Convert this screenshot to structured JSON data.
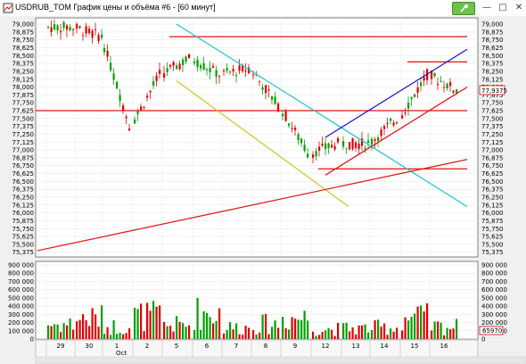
{
  "window": {
    "title": "USDRUB_TOM График цены и объёма #6 - [60 минут]",
    "minimize_icon": "minimize-icon",
    "maximize_icon": "maximize-icon",
    "close_icon": "close-icon",
    "pin_icon": "pin-icon"
  },
  "price_axis": {
    "labels": [
      "79,000",
      "78,875",
      "78,750",
      "78,625",
      "78,500",
      "78,375",
      "78,250",
      "78,125",
      "78,000",
      "77,875",
      "77,750",
      "77,625",
      "77,500",
      "77,375",
      "77,250",
      "77,125",
      "77,000",
      "76,875",
      "76,750",
      "76,625",
      "76,500",
      "76,375",
      "76,250",
      "76,125",
      "76,000",
      "75,875",
      "75,750",
      "75,625",
      "75,500",
      "75,375"
    ],
    "current_price": "77,9375",
    "current_price_color": "#e00000"
  },
  "volume_axis": {
    "labels": [
      "900 000",
      "800 000",
      "700 000",
      "600 000",
      "500 000",
      "400 000",
      "300 000",
      "200 000",
      "100 000",
      "0"
    ],
    "current_volume": "65970",
    "current_volume_color": "#e00000"
  },
  "time_axis": {
    "day_labels": [
      "29",
      "30",
      "1",
      "2",
      "5",
      "6",
      "7",
      "8",
      "9",
      "12",
      "13",
      "14",
      "15",
      "16"
    ],
    "month_label": "Oct"
  },
  "colors": {
    "up_candle": "#00a000",
    "down_candle": "#e00000",
    "volume_up": "#00a000",
    "volume_down": "#e00000",
    "cyan_line": "#20c0d0",
    "yellow_line": "#c8c820",
    "blue_line": "#1010d0",
    "red_line": "#e01010"
  },
  "chart_data": {
    "type": "line",
    "title": "",
    "xlabel": "",
    "ylabel": "",
    "ylim": [
      75.3,
      79.1
    ],
    "volume_ylim": [
      0,
      900000
    ],
    "categories": [
      "29",
      "30",
      "1",
      "2",
      "5",
      "6",
      "7",
      "8",
      "9",
      "12",
      "13",
      "14",
      "15",
      "16"
    ],
    "series": [
      {
        "values": [
          78.95,
          78.8,
          77.4,
          78.2,
          78.45,
          78.2,
          78.3,
          77.7,
          76.95,
          77.1,
          77.1,
          77.5,
          78.2,
          77.95
        ]
      }
    ],
    "volume": [
      180000,
      250000,
      150000,
      280000,
      170000,
      320000,
      140000,
      180000,
      260000,
      120000,
      130000,
      140000,
      260000,
      150000
    ],
    "trend_lines": [
      {
        "color_key": "cyan_line",
        "from": [
          "5",
          79.0
        ],
        "to": [
          "16",
          76.1
        ]
      },
      {
        "color_key": "yellow_line",
        "from": [
          "5",
          78.1
        ],
        "to": [
          "12",
          76.1
        ]
      },
      {
        "color_key": "blue_line",
        "from": [
          "12",
          77.2
        ],
        "to": [
          "16",
          78.6
        ]
      },
      {
        "color_key": "red_line",
        "from": [
          "12",
          76.6
        ],
        "to": [
          "16",
          78.0
        ]
      },
      {
        "color_key": "red_line",
        "from": [
          "29",
          75.4
        ],
        "to": [
          "16",
          76.85
        ]
      }
    ],
    "horizontal_levels": [
      {
        "color_key": "red_line",
        "value": 78.8,
        "from": "5"
      },
      {
        "color_key": "red_line",
        "value": 78.4,
        "from": "15"
      },
      {
        "color_key": "red_line",
        "value": 77.625,
        "from": "29"
      },
      {
        "color_key": "red_line",
        "value": 76.7,
        "from": "12"
      }
    ]
  }
}
